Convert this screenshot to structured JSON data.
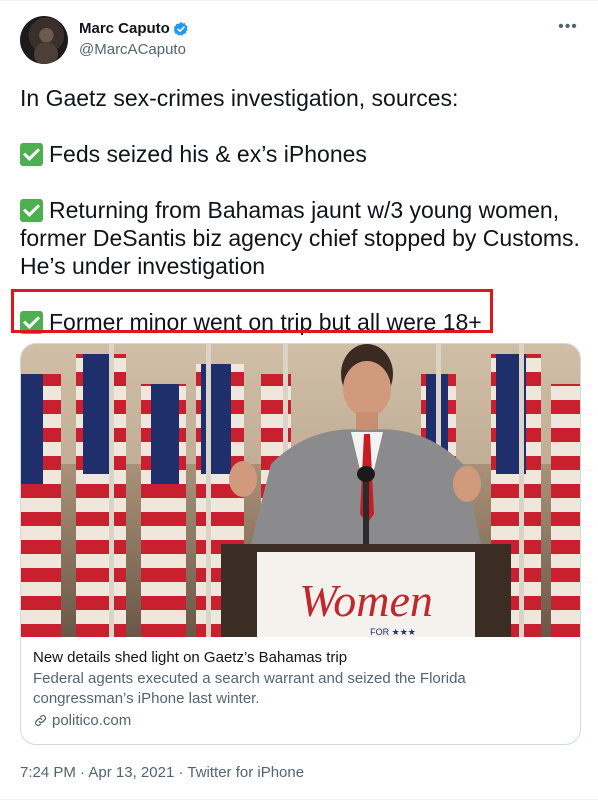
{
  "author": {
    "display_name": "Marc Caputo",
    "handle": "@MarcACaputo"
  },
  "tweet": {
    "lines": [
      "In Gaetz sex-crimes investigation, sources:",
      "Feds seized his & ex’s iPhones",
      "Returning from Bahamas jaunt w/3 young women,",
      "former DeSantis biz agency chief stopped by Customs.",
      "He’s under investigation",
      "Former minor went on trip but all were 18+"
    ]
  },
  "card": {
    "sign_text": "Women",
    "sign_subtext": "FOR ★★★",
    "title": "New details shed light on Gaetz’s Bahamas trip",
    "description": "Federal agents executed a search warrant and seized the Florida congressman’s iPhone last winter.",
    "domain": "politico.com"
  },
  "footer": {
    "time": "7:24 PM",
    "separator1": " · ",
    "date": "Apr 13, 2021",
    "separator2": " · ",
    "source": "Twitter for iPhone"
  },
  "colors": {
    "highlight": "#e0161e",
    "verified": "#1d9bf0",
    "check": "#4caf50"
  },
  "icons": [
    "verified-badge-icon",
    "more-options-icon",
    "checkmark-icon",
    "link-icon"
  ]
}
